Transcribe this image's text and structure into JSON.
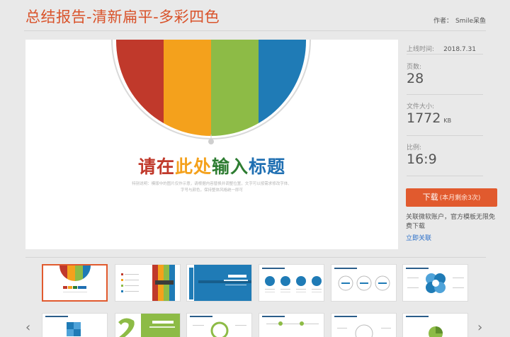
{
  "header": {
    "title": "总结报告-清新扁平-多彩四色",
    "author_label": "作者：",
    "author_name": "Smile呆鱼"
  },
  "preview": {
    "slide_title_part1": "请在",
    "slide_title_part2": "此处",
    "slide_title_part3": "输入",
    "slide_title_part4": "标题",
    "slide_subtitle": "特别说明：模版中的图片仅作示意，请根据内容替换并调整位置，文字可以按需求修改字体、字号与颜色，保持整体风格统一即可",
    "colors": [
      "#c0392b",
      "#f4a11c",
      "#8dbb46",
      "#1f7bb6"
    ]
  },
  "meta": {
    "online_label": "上线时间:",
    "online_value": "2018.7.31",
    "pages_label": "页数:",
    "pages_value": "28",
    "size_label": "文件大小:",
    "size_value": "1772",
    "size_unit": "KB",
    "ratio_label": "比例:",
    "ratio_value": "16:9"
  },
  "download": {
    "label": "下载",
    "remaining": "(本月剩余3次)"
  },
  "note": {
    "text": "关联微软账户，官方模板无限免费下载",
    "link": "立即关联"
  },
  "thumbs_nav": {
    "prev": "‹",
    "next": "›"
  }
}
